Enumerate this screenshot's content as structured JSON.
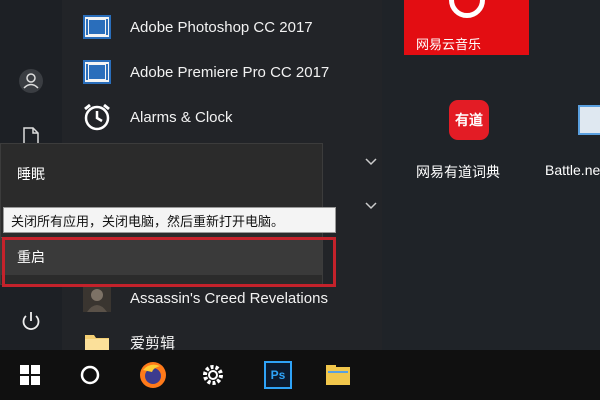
{
  "apps": [
    {
      "label": "Adobe Photoshop CC 2017",
      "icon": "adobe-app-icon"
    },
    {
      "label": "Adobe Premiere Pro CC 2017",
      "icon": "adobe-app-icon"
    },
    {
      "label": "Alarms & Clock",
      "icon": "alarm-clock-icon"
    },
    {
      "label": "Assassin's Creed Revelations",
      "icon": "game-icon"
    },
    {
      "label": "爱剪辑",
      "icon": "folder-icon"
    }
  ],
  "power_menu": {
    "sleep_label": "睡眠",
    "restart_label": "重启",
    "tooltip": "关闭所有应用，关闭电脑，然后重新打开电脑。"
  },
  "tiles": [
    {
      "label": "网易云音乐",
      "color": "#e30d12",
      "icon": "netease-music-icon"
    },
    {
      "label": "网易有道词典",
      "badge": "有道",
      "color": "#e31c25",
      "icon": "youdao-icon"
    },
    {
      "label": "Battle.ne",
      "icon": "battlenet-icon"
    }
  ],
  "taskbar": {
    "ps_label": "Ps",
    "icons": [
      "windows-start-icon",
      "cortana-icon",
      "firefox-icon",
      "settings-gear-icon",
      "photoshop-icon",
      "file-explorer-icon"
    ]
  },
  "colors": {
    "highlight": "#c4222b",
    "accent_red": "#e30d12"
  }
}
